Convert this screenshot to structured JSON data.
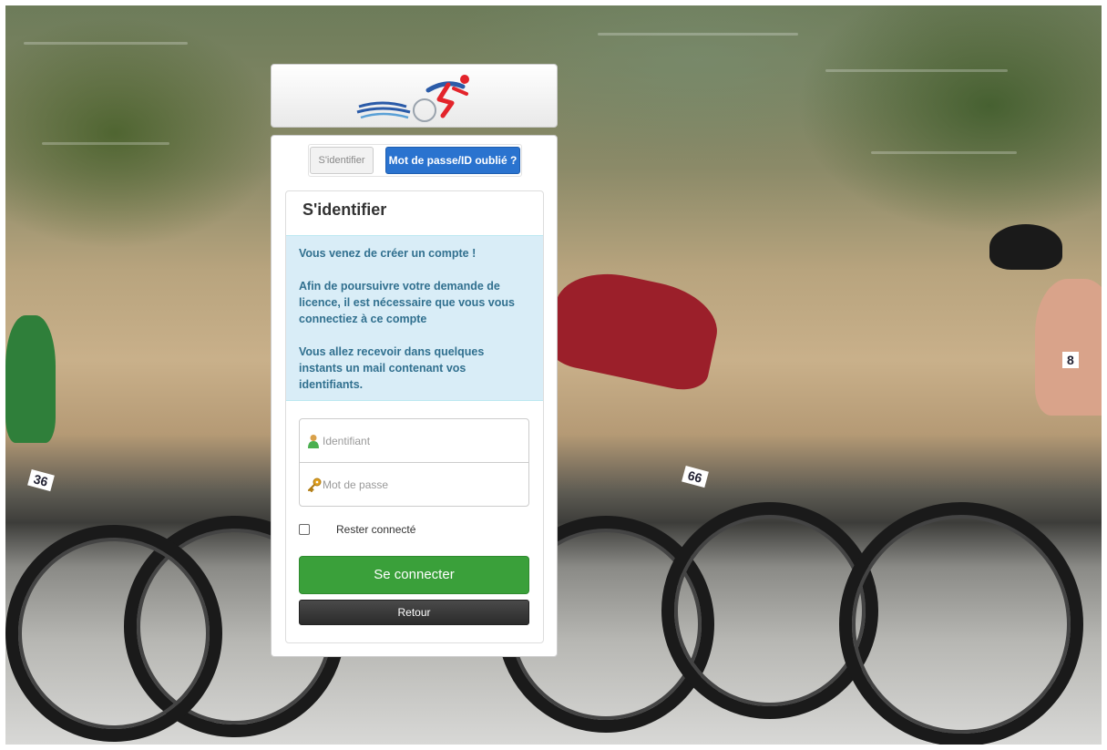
{
  "tabs": {
    "identify_label": "S'identifier",
    "forgot_label": "Mot de passe/ID oublié ?"
  },
  "card": {
    "title": "S'identifier",
    "alert": {
      "line1": "Vous venez de créer un compte !",
      "line2": "Afin de poursuivre votre demande de licence, il est nécessaire que vous vous connectiez à ce compte",
      "line3": "Vous allez recevoir dans quelques instants un mail contenant vos identifiants."
    }
  },
  "form": {
    "identifier_placeholder": "Identifiant",
    "password_placeholder": "Mot de passe",
    "remember_label": "Rester connecté",
    "remember_checked": false,
    "login_label": "Se connecter",
    "back_label": "Retour"
  },
  "background": {
    "bib_numbers": [
      "36",
      "66",
      "8"
    ]
  },
  "colors": {
    "login_button": "#3aa03a",
    "forgot_button": "#2a73cf",
    "alert_bg": "#d9edf7",
    "alert_text": "#31708f"
  }
}
